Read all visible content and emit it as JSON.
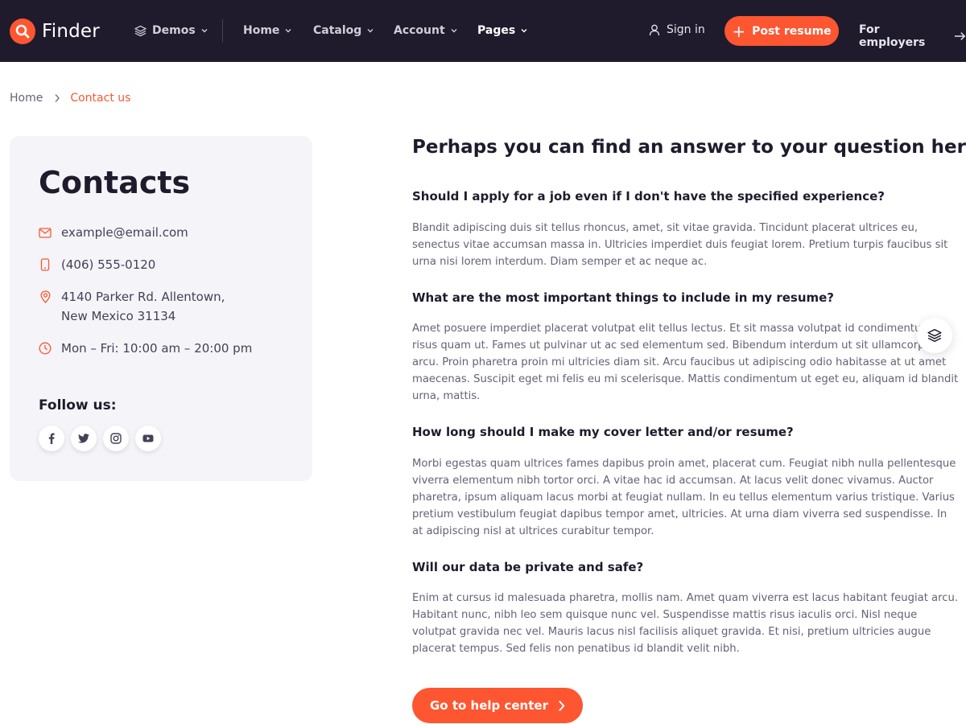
{
  "header": {
    "logo_text": "Finder",
    "nav": [
      {
        "label": "Demos",
        "icon": "layers-icon"
      },
      {
        "label": "Home"
      },
      {
        "label": "Catalog"
      },
      {
        "label": "Account"
      },
      {
        "label": "Pages",
        "active": true
      }
    ],
    "sign_in": "Sign in",
    "post_resume": "Post resume",
    "for_employers": "For employers"
  },
  "breadcrumb": {
    "home": "Home",
    "current": "Contact us"
  },
  "contacts": {
    "title": "Contacts",
    "email": "example@email.com",
    "phone": "(406) 555-0120",
    "address_line1": "4140 Parker Rd. Allentown,",
    "address_line2": "New Mexico 31134",
    "hours": "Mon – Fri: 10:00 am – 20:00 pm",
    "follow_label": "Follow us:",
    "socials": [
      "facebook-icon",
      "twitter-icon",
      "instagram-icon",
      "youtube-icon"
    ]
  },
  "faq": {
    "title": "Perhaps you can find an answer to your question here:",
    "items": [
      {
        "question": "Should I apply for a job even if I don't have the specified experience?",
        "answer": "Blandit adipiscing duis sit tellus rhoncus, amet, sit vitae gravida. Tincidunt placerat ultrices eu, senectus vitae accumsan massa in. Ultricies imperdiet duis feugiat lorem. Pretium turpis faucibus sit urna nisi lorem interdum. Diam semper et ac neque ac."
      },
      {
        "question": "What are the most important things to include in my resume?",
        "answer": "Amet posuere imperdiet placerat volutpat elit tellus lectus. Et sit massa volutpat id condimentum risus quam ut. Fames ut pulvinar ut ac sed elementum sed. Bibendum interdum ut sit ullamcorper arcu. Proin pharetra proin mi ultricies diam sit. Arcu faucibus ut adipiscing odio habitasse at ut amet maecenas. Suscipit eget mi felis eu mi scelerisque. Mattis condimentum ut eget eu, aliquam id blandit urna, mattis."
      },
      {
        "question": "How long should I make my cover letter and/or resume?",
        "answer": "Morbi egestas quam ultrices fames dapibus proin amet, placerat cum. Feugiat nibh nulla pellentesque viverra elementum nibh tortor orci. A vitae hac id accumsan. At lacus velit donec vivamus. Auctor pharetra, ipsum aliquam lacus morbi at feugiat nullam. In eu tellus elementum varius tristique. Varius pretium vestibulum feugiat dapibus tempor amet, ultricies. At urna diam viverra sed suspendisse. In at adipiscing nisl at ultrices curabitur tempor."
      },
      {
        "question": "Will our data be private and safe?",
        "answer": "Enim at cursus id malesuada pharetra, mollis nam. Amet quam viverra est lacus habitant feugiat arcu. Habitant nunc, nibh leo sem quisque nunc vel. Suspendisse mattis risus iaculis orci. Nisl neque volutpat gravida nec vel. Mauris lacus nisl facilisis aliquet gravida. Et nisi, pretium ultricies augue placerat tempus. Sed felis non penatibus id blandit velit nibh."
      }
    ],
    "help_button": "Go to help center"
  },
  "colors": {
    "accent": "#fd5631",
    "header_bg": "#1f1b2d",
    "card_bg": "#f5f4f8",
    "text_dark": "#1f1b2d",
    "text_muted": "#666276"
  },
  "floating_button_icon": "layers-icon"
}
